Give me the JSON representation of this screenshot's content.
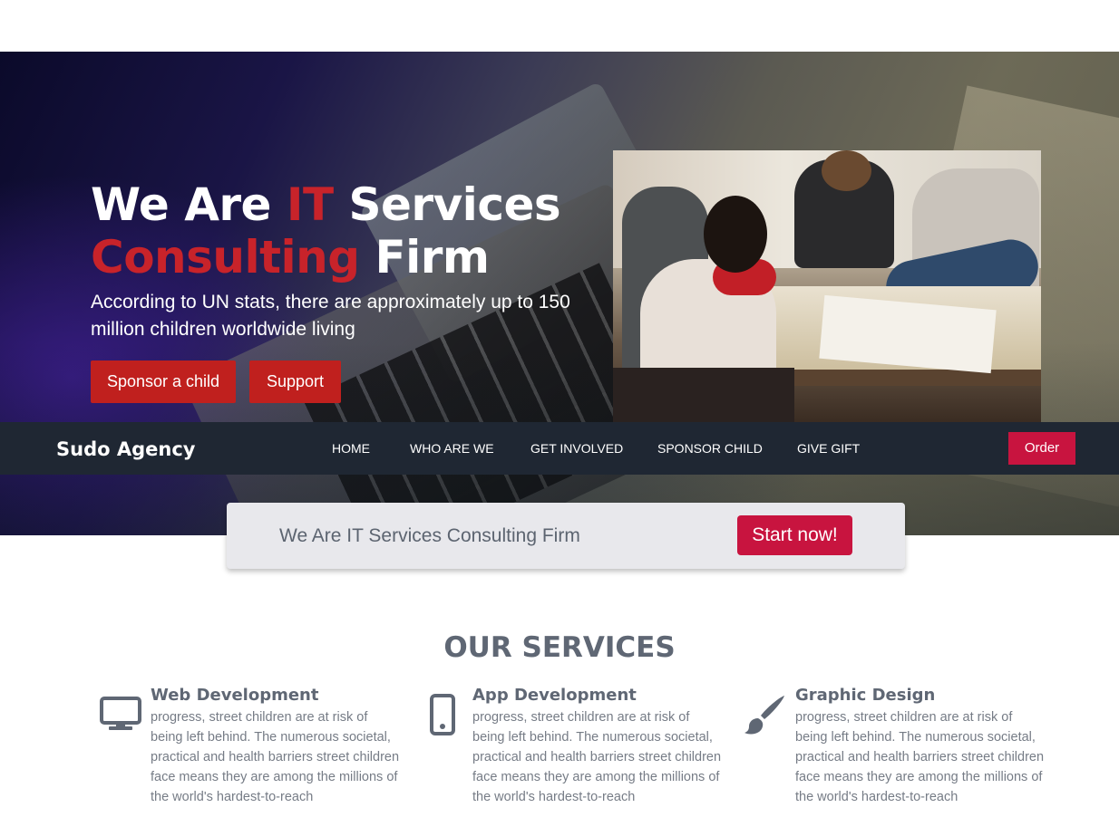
{
  "hero": {
    "title_part1": "We Are ",
    "title_red1": "IT",
    "title_part2": " Services",
    "title_red2": "Consulting",
    "title_part3": " Firm",
    "subtitle": "According to UN stats, there are approximately up to 150 million children worldwide living",
    "buttons": {
      "sponsor": "Sponsor a child",
      "support": "Support"
    }
  },
  "navbar": {
    "brand": "Sudo Agency",
    "items": [
      "HOME",
      "WHO ARE WE",
      "GET INVOLVED",
      "SPONSOR CHILD",
      "GIVE GIFT"
    ],
    "order": "Order"
  },
  "cta": {
    "text": "We Are IT Services Consulting Firm",
    "button": "Start now!"
  },
  "services": {
    "title": "OUR SERVICES",
    "items": [
      {
        "name": "Web Development",
        "icon": "desktop-icon",
        "desc": "progress, street children are at risk of being left behind. The numerous societal, practical and health barriers street children face means they are among the millions of the world's hardest-to-reach"
      },
      {
        "name": "App Development",
        "icon": "mobile-icon",
        "desc": "progress, street children are at risk of being left behind. The numerous societal, practical and health barriers street children face means they are among the millions of the world's hardest-to-reach"
      },
      {
        "name": "Graphic Design",
        "icon": "paint-brush-icon",
        "desc": "progress, street children are at risk of being left behind. The numerous societal, practical and health barriers street children face means they are among the millions of the world's hardest-to-reach"
      }
    ]
  },
  "colors": {
    "accent_red": "#c8232a",
    "button_red": "#c0201e",
    "cta_red": "#c8143f",
    "navbar_bg": "#1f2733",
    "heading_gray": "#5f6774"
  }
}
